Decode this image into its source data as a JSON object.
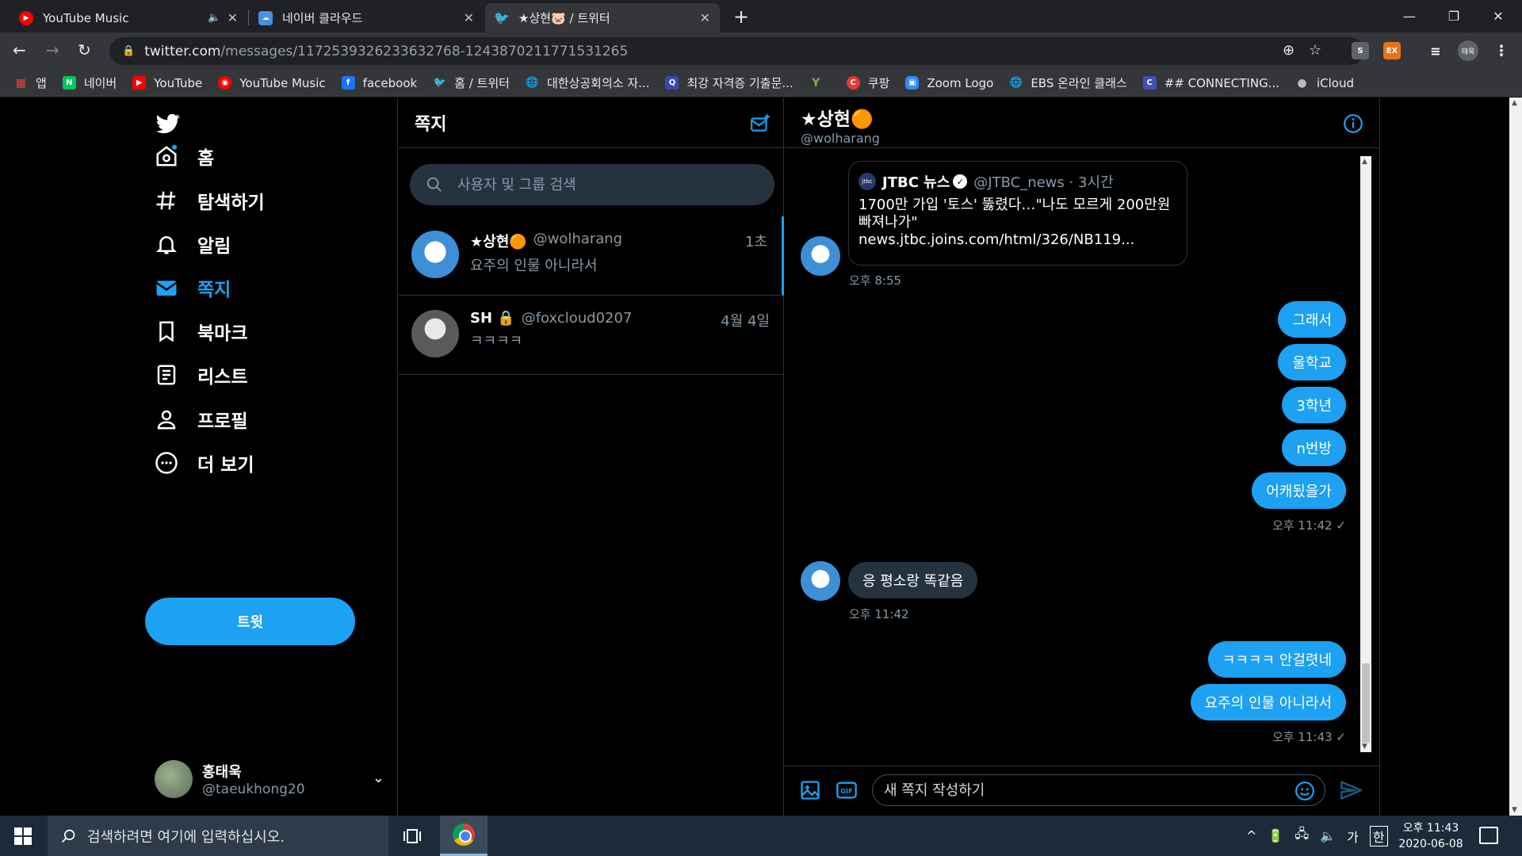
{
  "browser": {
    "tabs": [
      {
        "title": "YouTube Music",
        "mute_icon": "🔈",
        "close": "✕"
      },
      {
        "title": "네이버 클라우드",
        "close": "✕"
      },
      {
        "title": "★상현🐷 / 트위터",
        "close": "✕"
      }
    ],
    "new_tab": "+",
    "window_controls": {
      "minimize": "—",
      "restore": "❐",
      "close": "✕"
    },
    "nav": {
      "back": "←",
      "forward": "→",
      "reload": "↻"
    },
    "url_host": "twitter.com",
    "url_path": "/messages/1172539326233632768-1243870211771531265",
    "extensions": [
      "S",
      "EX"
    ],
    "profile_label": "태욱",
    "bookmarks": [
      {
        "label": "앱",
        "color": "#ea4335"
      },
      {
        "label": "네이버",
        "color": "#03c75a",
        "glyph": "N"
      },
      {
        "label": "YouTube",
        "color": "#ff0000",
        "glyph": "▶"
      },
      {
        "label": "YouTube Music",
        "color": "#ff0000",
        "glyph": "◉"
      },
      {
        "label": "facebook",
        "color": "#1877f2",
        "glyph": "f"
      },
      {
        "label": "홈 / 트위터",
        "color": "#1da1f2",
        "glyph": "🐦"
      },
      {
        "label": "대한상공회의소 자...",
        "color": "#5f6368",
        "glyph": "🌐"
      },
      {
        "label": "최강 자격증 기출문...",
        "color": "#3949ab",
        "glyph": "Q"
      },
      {
        "label": "",
        "color": "#7cb342",
        "glyph": "Y"
      },
      {
        "label": "쿠팡",
        "color": "#e53935",
        "glyph": "C"
      },
      {
        "label": "Zoom Logo",
        "color": "#2d8cff",
        "glyph": "▣"
      },
      {
        "label": "EBS 온라인 클래스",
        "color": "#5f6368",
        "glyph": "🌐"
      },
      {
        "label": "## CONNECTING...",
        "color": "#3f51b5",
        "glyph": "C"
      },
      {
        "label": "iCloud",
        "color": "#5f6368",
        "glyph": ""
      }
    ]
  },
  "twitter": {
    "nav": {
      "home": "홈",
      "explore": "탐색하기",
      "notifications": "알림",
      "messages": "쪽지",
      "bookmarks": "북마크",
      "lists": "리스트",
      "profile": "프로필",
      "more": "더 보기",
      "tweet_button": "트윗"
    },
    "account": {
      "name": "홍태욱",
      "handle": "@taeukhong20"
    },
    "dm_list": {
      "title": "쪽지",
      "search_placeholder": "사용자 및 그룹 검색",
      "conversations": [
        {
          "name": "★상현🟠",
          "handle": "@wolharang",
          "time": "1초",
          "preview": "요주의 인물 아니라서"
        },
        {
          "name": "SH 🔒",
          "handle": "@foxcloud0207",
          "time": "4월 4일",
          "preview": "ㅋㅋㅋㅋ"
        }
      ]
    },
    "chat": {
      "name": "★상현🟠",
      "handle": "@wolharang",
      "shared_tweet": {
        "source_logo": "jtbc",
        "source": "JTBC 뉴스",
        "verified": "✓",
        "handle": "@JTBC_news · 3시간",
        "text": "1700만 가입 '토스' 뚫렸다…\"나도 모르게 200만원 빠져나가\"",
        "link": "news.jtbc.joins.com/html/326/NB119..."
      },
      "timestamps": {
        "t1": "오후 8:55",
        "t2": "오후 11:42 ✓",
        "t3": "오후 11:42",
        "t4": "오후 11:43 ✓"
      },
      "sent_1": [
        "그래서",
        "울학교",
        "3학년",
        "n번방",
        "어캐됬을가"
      ],
      "received": "응 평소랑 똑같음",
      "sent_2": [
        "ㅋㅋㅋㅋ 안걸렷네",
        "요주의 인물 아니라서"
      ],
      "composer_placeholder": "새 쪽지 작성하기"
    }
  },
  "taskbar": {
    "search_placeholder": "검색하려면 여기에 입력하십시오.",
    "tray_items": [
      "^",
      "🔋",
      "🖧",
      "🔈",
      "가",
      "한"
    ],
    "clock_time": "오후 11:43",
    "clock_date": "2020-06-08"
  },
  "colors": {
    "accent": "#1da1f2",
    "bubble_them": "#253341",
    "border": "#2f3336"
  }
}
